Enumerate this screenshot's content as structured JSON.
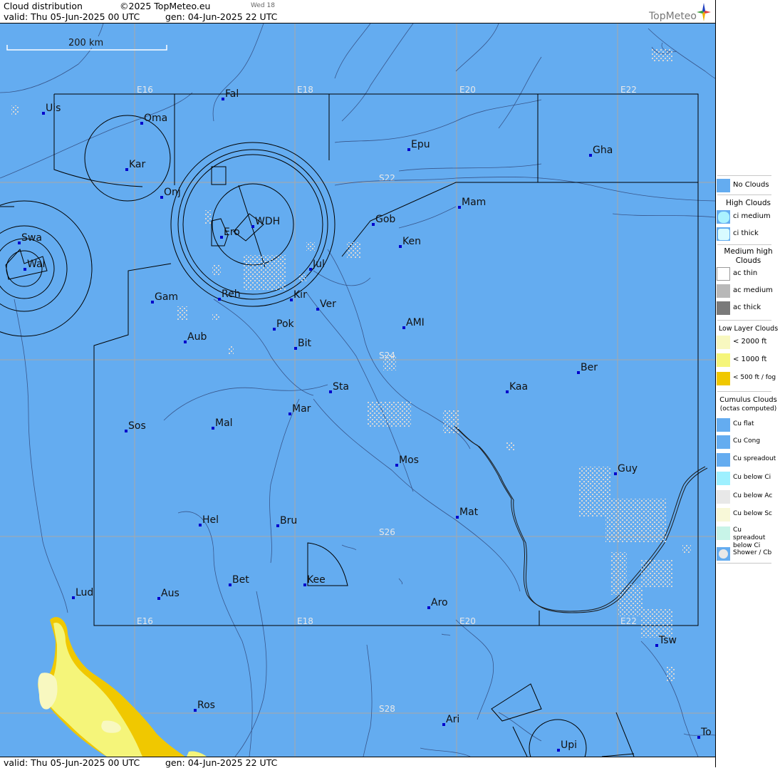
{
  "header": {
    "title": "Cloud distribution",
    "copyright": "©2025 TopMeteo.eu",
    "day_code": "Wed 18",
    "valid": "valid:  Thu  05-Jun-2025  00 UTC",
    "gen": "gen: 04-Jun-2025 22 UTC",
    "logo_text": "TopMeteo"
  },
  "footer": {
    "valid": "valid:  Thu  05-Jun-2025  00 UTC",
    "gen": "gen: 04-Jun-2025 22 UTC"
  },
  "scale_bar": {
    "label": "200 km"
  },
  "grid_labels": {
    "lon_top": [
      "E16",
      "E18",
      "E20",
      "E22"
    ],
    "lon_bottom": [
      "E16",
      "E18",
      "E20",
      "E22"
    ],
    "lat": [
      "S22",
      "S24",
      "S26",
      "S28"
    ]
  },
  "places": [
    {
      "name": "Uis"
    },
    {
      "name": "Fal"
    },
    {
      "name": "Oma"
    },
    {
      "name": "Kar"
    },
    {
      "name": "Epu"
    },
    {
      "name": "Gha"
    },
    {
      "name": "Onj"
    },
    {
      "name": "Mam"
    },
    {
      "name": "Gob"
    },
    {
      "name": "WDH"
    },
    {
      "name": "Swa"
    },
    {
      "name": "Ero"
    },
    {
      "name": "Ken"
    },
    {
      "name": "Wal"
    },
    {
      "name": "Jul"
    },
    {
      "name": "Gam"
    },
    {
      "name": "Reh"
    },
    {
      "name": "Kir"
    },
    {
      "name": "Ver"
    },
    {
      "name": "Pok"
    },
    {
      "name": "AMI"
    },
    {
      "name": "Aub"
    },
    {
      "name": "Bit"
    },
    {
      "name": "Ber"
    },
    {
      "name": "Sta"
    },
    {
      "name": "Kaa"
    },
    {
      "name": "Mar"
    },
    {
      "name": "Sos"
    },
    {
      "name": "Mal"
    },
    {
      "name": "Mos"
    },
    {
      "name": "Guy"
    },
    {
      "name": "Mat"
    },
    {
      "name": "Hel"
    },
    {
      "name": "Bru"
    },
    {
      "name": "Bet"
    },
    {
      "name": "Kee"
    },
    {
      "name": "Lud"
    },
    {
      "name": "Aus"
    },
    {
      "name": "Aro"
    },
    {
      "name": "Tsw"
    },
    {
      "name": "Ros"
    },
    {
      "name": "Ari"
    },
    {
      "name": "To"
    },
    {
      "name": "Upi"
    }
  ],
  "legend": {
    "no_clouds": "No Clouds",
    "high_title": "High Clouds",
    "ci_medium": "ci medium",
    "ci_thick": "ci thick",
    "medium_title": "Medium high Clouds",
    "ac_thin": "ac thin",
    "ac_medium": "ac medium",
    "ac_thick": "ac thick",
    "low_title": "Low Layer Clouds",
    "low_2000": "< 2000 ft",
    "low_1000": "< 1000 ft",
    "low_500": "< 500 ft / fog",
    "cu_title": "Cumulus Clouds",
    "cu_sub": "(octas computed)",
    "cu_flat": "Cu flat",
    "cu_cong": "Cu Cong",
    "cu_spread": "Cu spreadout",
    "cu_below_ci": "Cu below Ci",
    "cu_below_ac": "Cu below Ac",
    "cu_below_sc": "Cu below Sc",
    "cu_spread_ci": "Cu spreadout below Ci",
    "shower": "Shower / Cb"
  },
  "colors": {
    "sea_land": "#64acf0",
    "grid": "#a8a8a8",
    "cu_below_ac": "#d8d8d8",
    "low_1000": "#f5f57a",
    "low_500": "#f0c800",
    "low_2000": "#f8f8c0",
    "place_marker": "#0000cc"
  }
}
